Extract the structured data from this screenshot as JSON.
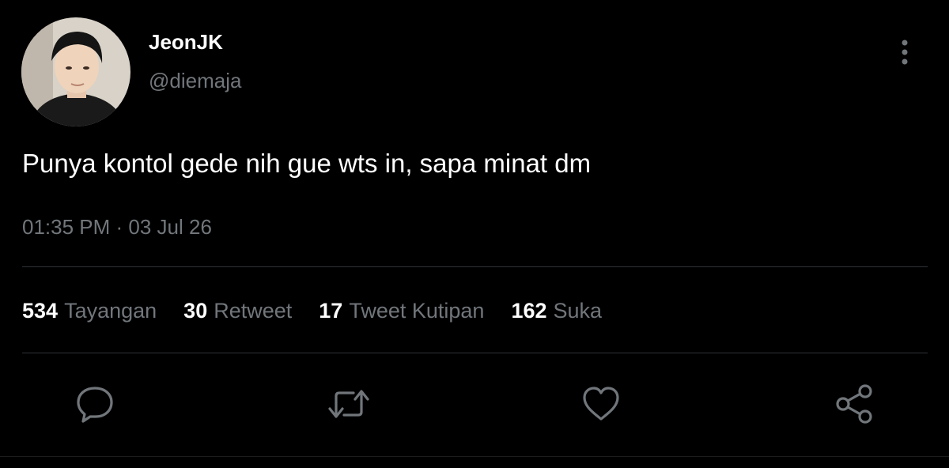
{
  "tweet": {
    "display_name": "JeonJK",
    "handle": "@diemaja",
    "text": "Punya kontol gede nih gue wts in, sapa minat dm",
    "timestamp": "01:35 PM · 03 Jul 26"
  },
  "stats": [
    {
      "count": "534",
      "label": "Tayangan"
    },
    {
      "count": "30",
      "label": "Retweet"
    },
    {
      "count": "17",
      "label": "Tweet Kutipan"
    },
    {
      "count": "162",
      "label": "Suka"
    }
  ],
  "actions": {
    "reply_icon": "speech-bubble-icon",
    "retweet_icon": "retweet-arrows-icon",
    "like_icon": "heart-icon",
    "share_icon": "share-icon"
  },
  "colors": {
    "background": "#000000",
    "text_primary": "#ffffff",
    "text_secondary": "#71767b",
    "divider": "#2f3336"
  }
}
